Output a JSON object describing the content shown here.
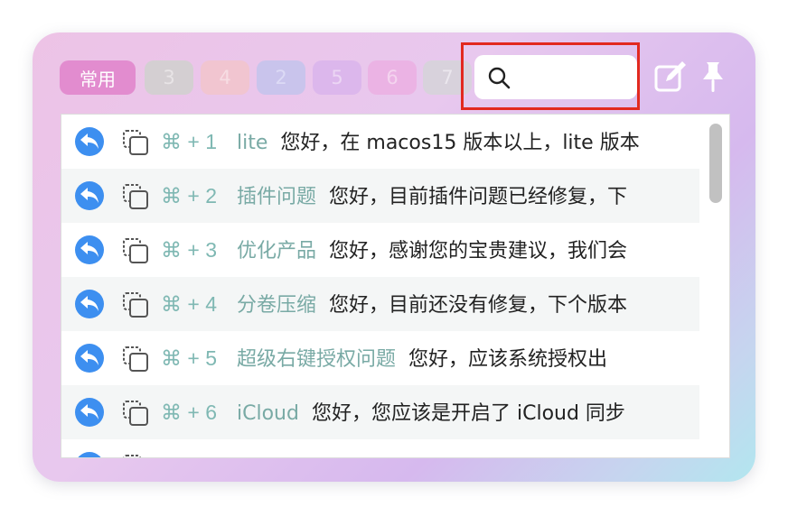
{
  "tabs": [
    {
      "label": "常用"
    },
    {
      "label": "3"
    },
    {
      "label": "4"
    },
    {
      "label": "2"
    },
    {
      "label": "5"
    },
    {
      "label": "6"
    },
    {
      "label": "7"
    }
  ],
  "search": {
    "value": "",
    "placeholder": ""
  },
  "rows": [
    {
      "shortcut": "⌘ + 1",
      "title": "lite",
      "body": "您好，在 macos15 版本以上，lite 版本"
    },
    {
      "shortcut": "⌘ + 2",
      "title": "插件问题",
      "body": "您好，目前插件问题已经修复，下"
    },
    {
      "shortcut": "⌘ + 3",
      "title": "优化产品",
      "body": "您好，感谢您的宝贵建议，我们会"
    },
    {
      "shortcut": "⌘ + 4",
      "title": "分卷压缩",
      "body": "您好，目前还没有修复，下个版本"
    },
    {
      "shortcut": "⌘ + 5",
      "title": "超级右键授权问题",
      "body": "您好，应该系统授权出"
    },
    {
      "shortcut": "⌘ + 6",
      "title": "iCloud",
      "body": "您好，您应该是开启了 iCloud 同步"
    }
  ]
}
